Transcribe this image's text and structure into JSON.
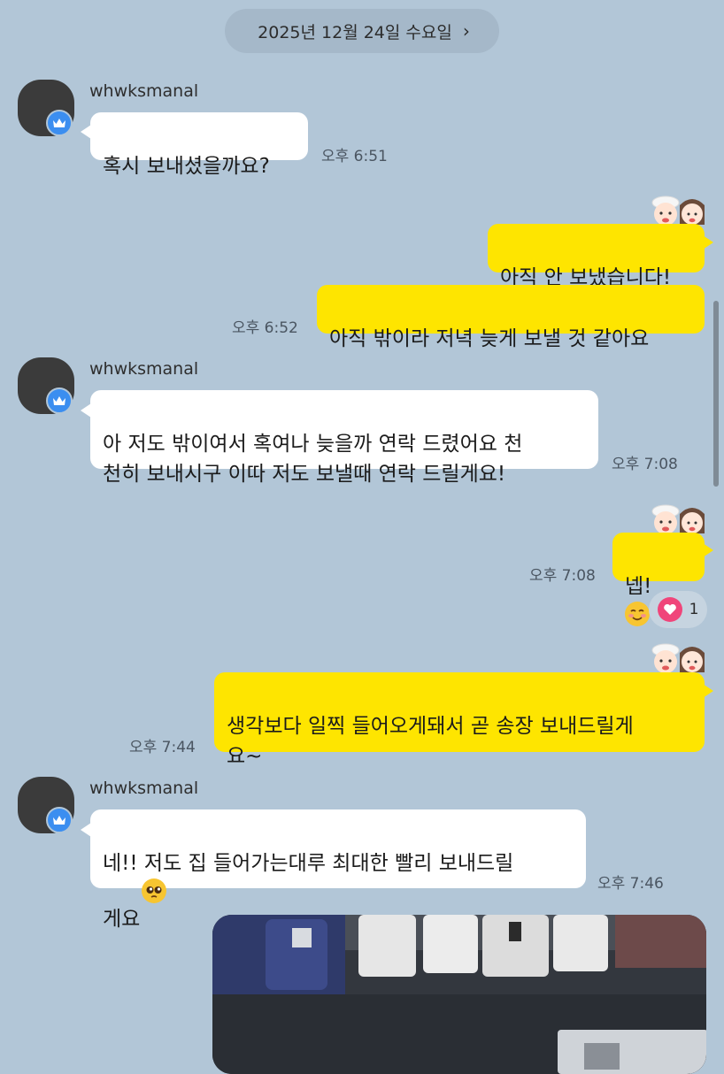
{
  "date_header": {
    "label": "2025년 12월 24일 수요일",
    "chevron": "›"
  },
  "messages": [
    {
      "from": "whwksmanal",
      "text": "혹시 보내셨을까요?",
      "time": "오후 6:51"
    },
    {
      "from": "me",
      "text": "아직 안 보냈습니다!"
    },
    {
      "from": "me",
      "text": "아직 밖이라 저녁 늦게 보낼 것 같아요",
      "time": "오후 6:52"
    },
    {
      "from": "whwksmanal",
      "text": "아 저도 밖이여서 혹여나 늦을까 연락 드렸어요 천\n천히 보내시구 이따 저도 보낼때 연락 드릴게요!",
      "time": "오후 7:08"
    },
    {
      "from": "me",
      "text": "넵! ",
      "emoji": "smiling-face-with-smiling-eyes",
      "time": "오후 7:08",
      "reaction": {
        "icon": "heart-icon",
        "count": "1"
      }
    },
    {
      "from": "me",
      "text": "생각보다 일찍 들어오게돼서 곧 송장 보내드릴게\n요~",
      "time": "오후 7:44"
    },
    {
      "from": "whwksmanal",
      "text": "네!! 저도 집 들어가는대루 최대한 빨리 보내드릴\n게요",
      "emoji": "pleading-face",
      "time": "오후 7:46"
    }
  ],
  "sender_name": "whwksmanal",
  "colors": {
    "background": "#b2c6d7",
    "outgoing": "#fee500",
    "incoming": "#ffffff",
    "badge": "#3b8ef0",
    "heart": "#f0457a"
  },
  "icons": {
    "badge": "crown-icon",
    "sticker": "couple-sticker-icon",
    "photo": "photo-attachment"
  }
}
